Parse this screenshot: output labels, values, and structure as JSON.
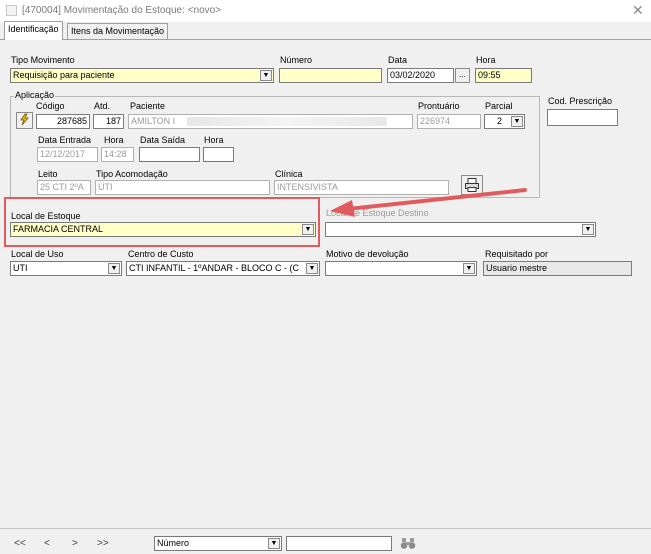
{
  "window": {
    "title": "[470004]  Movimentação do Estoque: <novo>"
  },
  "tabs": [
    "Identificação",
    "Itens da Movimentação"
  ],
  "tipo_movimento": {
    "label": "Tipo Movimento",
    "value": "Requisição para paciente"
  },
  "numero": {
    "label": "Número",
    "value": ""
  },
  "data": {
    "label": "Data",
    "value": "03/02/2020",
    "button": "..."
  },
  "hora": {
    "label": "Hora",
    "value": "09:55"
  },
  "aplicacao": {
    "legend": "Aplicação",
    "codigo": {
      "label": "Código",
      "value": "287685"
    },
    "atd": {
      "label": "Atd.",
      "value": "187"
    },
    "paciente": {
      "label": "Paciente",
      "value": "AMILTON I"
    },
    "prontuario": {
      "label": "Prontuário",
      "value": "226974"
    },
    "parcial": {
      "label": "Parcial",
      "value": "2"
    },
    "data_entrada": {
      "label": "Data Entrada",
      "value": "12/12/2017"
    },
    "hora_entrada": {
      "label": "Hora",
      "value": "14:28"
    },
    "data_saida": {
      "label": "Data Saída",
      "value": ""
    },
    "hora_saida": {
      "label": "Hora",
      "value": ""
    },
    "leito": {
      "label": "Leito",
      "value": "25 CTI 2ºA"
    },
    "tipo_acomodacao": {
      "label": "Tipo Acomodação",
      "value": "UTI"
    },
    "clinica": {
      "label": "Clínica",
      "value": "INTENSIVISTA"
    }
  },
  "cod_prescricao": {
    "label": "Cod. Prescrição",
    "value": ""
  },
  "local_estoque": {
    "label": "Local de Estoque",
    "value": "FARMACIA CENTRAL"
  },
  "local_estoque_destino": {
    "label": "Local de Estoque Destino",
    "value": ""
  },
  "local_uso": {
    "label": "Local de Uso",
    "value": "UTI"
  },
  "centro_custo": {
    "label": "Centro de Custo",
    "value": "CTI INFANTIL - 1ºANDAR - BLOCO C - (C"
  },
  "motivo_devolucao": {
    "label": "Motivo de devolução",
    "value": ""
  },
  "requisitado_por": {
    "label": "Requisitado por",
    "value": "Usuario mestre"
  },
  "bottom": {
    "nav": [
      "<<",
      "<",
      ">",
      ">>"
    ],
    "search_field": "Número",
    "search_value": ""
  },
  "colors": {
    "highlight_box": "#e05a60",
    "arrow": "#e05a60",
    "required_field": "#ffffc8"
  }
}
